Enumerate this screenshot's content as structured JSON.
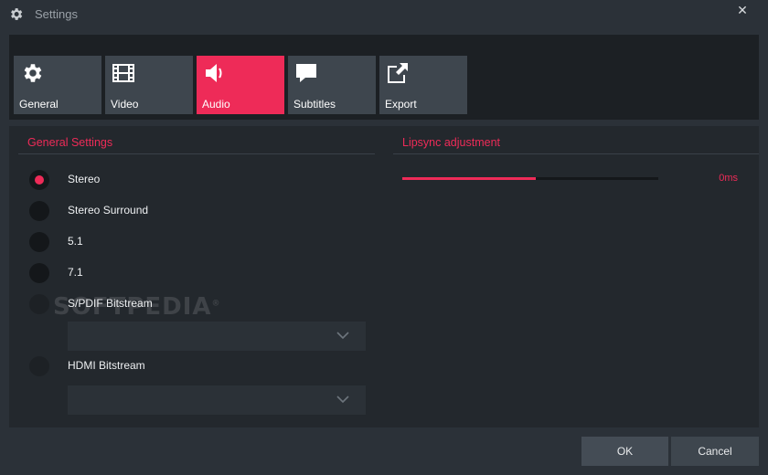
{
  "window": {
    "title": "Settings",
    "close_glyph": "✕",
    "title_icon": "gear-icon"
  },
  "tabs": [
    {
      "label": "General",
      "icon": "gear-icon",
      "active": false
    },
    {
      "label": "Video",
      "icon": "film-icon",
      "active": false
    },
    {
      "label": "Audio",
      "icon": "speaker-icon",
      "active": true
    },
    {
      "label": "Subtitles",
      "icon": "speech-bubble-icon",
      "active": false
    },
    {
      "label": "Export",
      "icon": "export-icon",
      "active": false
    }
  ],
  "general_settings": {
    "title": "General Settings",
    "options": [
      {
        "label": "Stereo",
        "checked": true
      },
      {
        "label": "Stereo Surround",
        "checked": false
      },
      {
        "label": "5.1",
        "checked": false
      },
      {
        "label": "7.1",
        "checked": false
      },
      {
        "label": "S/PDIF Bitstream",
        "checked": false
      },
      {
        "label": "HDMI Bitstream",
        "checked": false
      }
    ],
    "spdif_dropdown_value": "",
    "hdmi_dropdown_value": ""
  },
  "lipsync": {
    "title": "Lipsync adjustment",
    "value_text": "0ms",
    "slider_fraction": 0.52
  },
  "watermark": {
    "text": "SOFTPEDIA",
    "mark": "®"
  },
  "footer": {
    "ok_label": "OK",
    "cancel_label": "Cancel"
  },
  "colors": {
    "accent": "#ee2b58",
    "background": "#2b3138",
    "panel": "#23282d",
    "tab": "#3e464e"
  }
}
